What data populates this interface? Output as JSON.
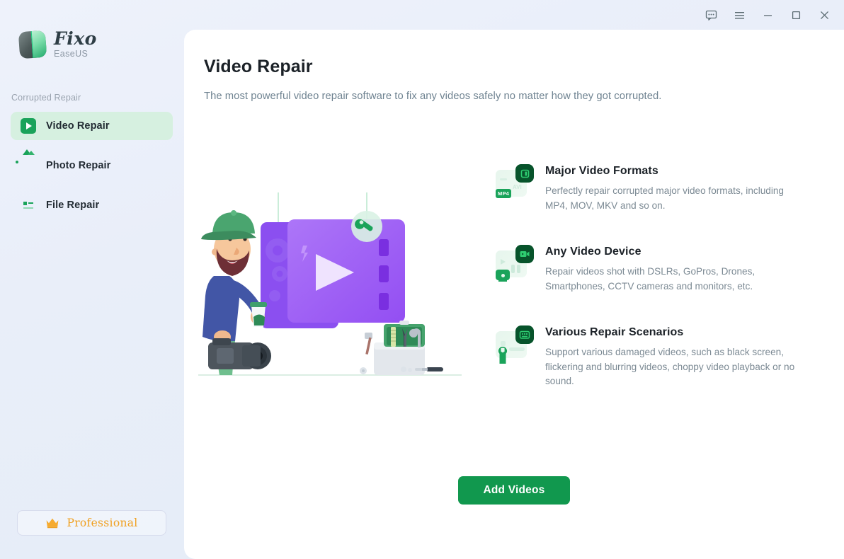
{
  "titlebar": {
    "buttons": [
      {
        "name": "feedback-icon",
        "label": "Feedback"
      },
      {
        "name": "menu-icon",
        "label": "Menu"
      },
      {
        "name": "minimize-icon",
        "label": "Minimize"
      },
      {
        "name": "maximize-icon",
        "label": "Maximize"
      },
      {
        "name": "close-icon",
        "label": "Close"
      }
    ]
  },
  "sidebar": {
    "logo": {
      "title": "Fixo",
      "subtitle": "EaseUS"
    },
    "section_label": "Corrupted Repair",
    "items": [
      {
        "label": "Video Repair",
        "icon": "video-icon",
        "active": true
      },
      {
        "label": "Photo Repair",
        "icon": "photo-icon",
        "active": false
      },
      {
        "label": "File Repair",
        "icon": "file-icon",
        "active": false
      }
    ],
    "pro_badge": {
      "label": "Professional",
      "icon": "crown-icon"
    }
  },
  "main": {
    "title": "Video Repair",
    "subtitle": "The most powerful video repair software to fix any videos safely no matter how they got corrupted.",
    "features": [
      {
        "title": "Major Video Formats",
        "desc": "Perfectly repair corrupted major video formats, including MP4, MOV, MKV and so on.",
        "icon": "video-formats-icon",
        "tag": "MP4",
        "ghost": "AVI"
      },
      {
        "title": "Any Video Device",
        "desc": "Repair videos shot with DSLRs, GoPros, Drones, Smartphones, CCTV cameras and monitors, etc.",
        "icon": "video-device-icon",
        "tag": "",
        "ghost": ""
      },
      {
        "title": "Various Repair Scenarios",
        "desc": "Support various damaged videos, such as black screen, flickering and blurring videos, choppy video playback or no sound.",
        "icon": "repair-scenarios-icon",
        "tag": "",
        "ghost": ""
      }
    ],
    "add_button": "Add Videos",
    "illustration": "video-repair-illustration"
  },
  "colors": {
    "brand_green": "#11984e",
    "accent_dark_green": "#07532b",
    "active_nav_bg": "#d6f0e0",
    "pro_orange": "#f0a020",
    "app_bg": "#e9eef9",
    "panel_bg": "#ffffff"
  }
}
